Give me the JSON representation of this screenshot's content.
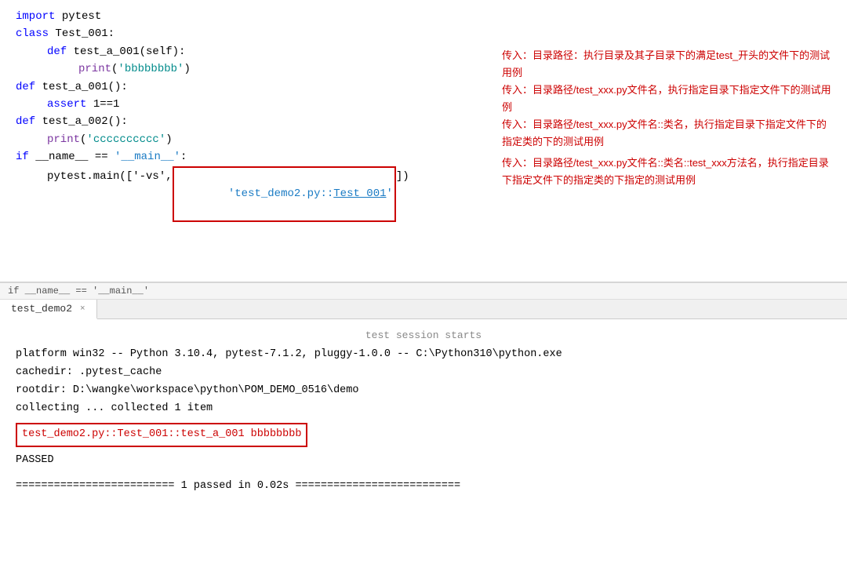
{
  "editor": {
    "lines": [
      {
        "indent": 0,
        "tokens": [
          {
            "type": "kw-blue",
            "text": "import"
          },
          {
            "type": "plain",
            "text": " pytest"
          }
        ]
      },
      {
        "indent": 0,
        "tokens": [
          {
            "type": "kw-blue",
            "text": "class"
          },
          {
            "type": "plain",
            "text": " Test_001:"
          }
        ]
      },
      {
        "indent": 1,
        "tokens": [
          {
            "type": "kw-blue",
            "text": "def"
          },
          {
            "type": "plain",
            "text": " test_a_001(self):"
          }
        ]
      },
      {
        "indent": 2,
        "tokens": [
          {
            "type": "kw-purple",
            "text": "print"
          },
          {
            "type": "plain",
            "text": "("
          },
          {
            "type": "str-teal",
            "text": "'bbbbbbbb'"
          },
          {
            "type": "plain",
            "text": ")"
          }
        ]
      },
      {
        "indent": 0,
        "tokens": [
          {
            "type": "kw-blue",
            "text": "def"
          },
          {
            "type": "plain",
            "text": " test_a_001():"
          }
        ]
      },
      {
        "indent": 1,
        "tokens": [
          {
            "type": "kw-blue",
            "text": "assert"
          },
          {
            "type": "plain",
            "text": " 1==1"
          }
        ]
      },
      {
        "indent": 0,
        "tokens": [
          {
            "type": "kw-blue",
            "text": "def"
          },
          {
            "type": "plain",
            "text": " test_a_002():"
          }
        ]
      },
      {
        "indent": 1,
        "tokens": [
          {
            "type": "kw-purple",
            "text": "print"
          },
          {
            "type": "plain",
            "text": "("
          },
          {
            "type": "str-teal",
            "text": "'cccccccccc'"
          },
          {
            "type": "plain",
            "text": ")"
          }
        ]
      },
      {
        "indent": 0,
        "tokens": [
          {
            "type": "kw-blue",
            "text": "if"
          },
          {
            "type": "plain",
            "text": " __name__ == "
          },
          {
            "type": "str-blue",
            "text": "'__main__'"
          },
          {
            "type": "plain",
            "text": ":"
          }
        ]
      },
      {
        "indent": 1,
        "tokens": [
          {
            "type": "plain",
            "text": "pytest.main(["
          },
          {
            "type": "plain",
            "text": "'-vs',"
          },
          {
            "type": "str-blue",
            "text": "'test_demo2.py::Test_001'"
          },
          {
            "type": "plain",
            "text": "])"
          }
        ]
      }
    ],
    "annotation": {
      "lines": [
        "传入：目录路径：执行目录及其子目录下的满足test_开头的文件下的测试用例",
        "传入：目录路径/test_xxx.py文件名，执行指定目录下指定文件下的测试用例",
        "传入：目录路径/test_xxx.py文件名::类名，执行指定目录下指定文件下的指定类的下的测试用例",
        "传入：目录路径/test_xxx.py文件名::类名::test_xxx方法名，执行指定目录下指定文件下的指定类的下指定的测试用例"
      ]
    }
  },
  "breadcrumb": {
    "text": "if __name__ == '__main__'"
  },
  "tabs": [
    {
      "label": "test_demo2",
      "active": true,
      "closable": true
    }
  ],
  "terminal": {
    "session_start": "test session starts",
    "platform_line": "platform win32 -- Python 3.10.4, pytest-7.1.2, pluggy-1.0.0 -- C:\\Python310\\python.exe",
    "cachedir_line": "cachedir: .pytest_cache",
    "rootdir_line": "rootdir: D:\\wangke\\workspace\\python\\POM_DEMO_0516\\demo",
    "collecting_line": "collecting ... collected 1 item",
    "test_result_line": "test_demo2.py::Test_001::test_a_001 bbbbbbbb",
    "passed_line": "PASSED",
    "summary_line": "========================= 1 passed in 0.02s =========================="
  }
}
